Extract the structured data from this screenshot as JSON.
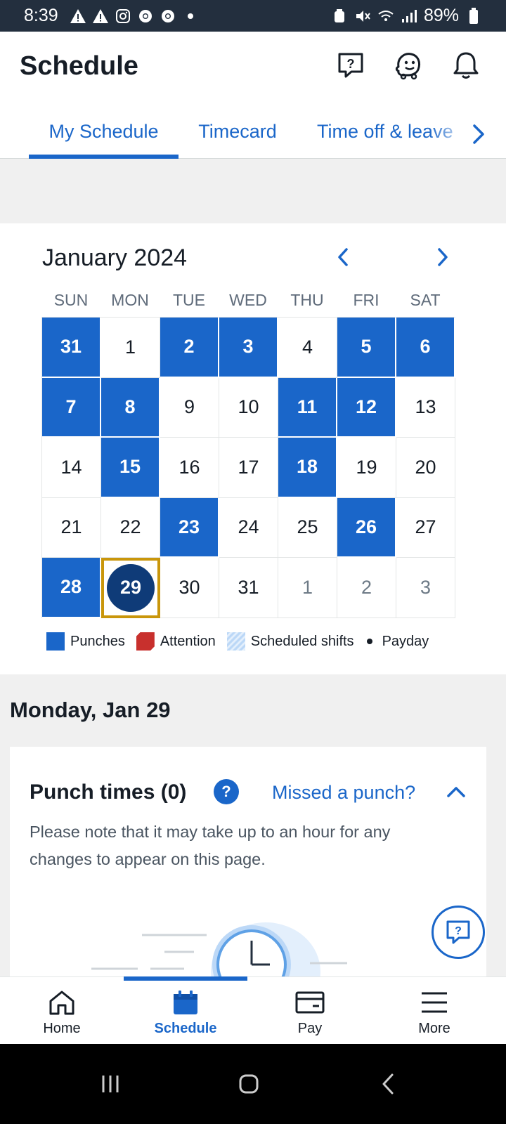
{
  "status_bar": {
    "time": "8:39",
    "battery": "89%"
  },
  "header": {
    "title": "Schedule",
    "tabs": [
      {
        "label": "My Schedule",
        "active": true
      },
      {
        "label": "Timecard",
        "active": false
      },
      {
        "label": "Time off & leave",
        "active": false
      }
    ]
  },
  "calendar": {
    "month": "January 2024",
    "weekdays": [
      "SUN",
      "MON",
      "TUE",
      "WED",
      "THU",
      "FRI",
      "SAT"
    ],
    "days": [
      {
        "label": "31",
        "state": "punch"
      },
      {
        "label": "1",
        "state": ""
      },
      {
        "label": "2",
        "state": "punch"
      },
      {
        "label": "3",
        "state": "punch"
      },
      {
        "label": "4",
        "state": ""
      },
      {
        "label": "5",
        "state": "punch"
      },
      {
        "label": "6",
        "state": "punch"
      },
      {
        "label": "7",
        "state": "punch"
      },
      {
        "label": "8",
        "state": "punch"
      },
      {
        "label": "9",
        "state": ""
      },
      {
        "label": "10",
        "state": ""
      },
      {
        "label": "11",
        "state": "punch"
      },
      {
        "label": "12",
        "state": "punch"
      },
      {
        "label": "13",
        "state": ""
      },
      {
        "label": "14",
        "state": ""
      },
      {
        "label": "15",
        "state": "punch"
      },
      {
        "label": "16",
        "state": ""
      },
      {
        "label": "17",
        "state": ""
      },
      {
        "label": "18",
        "state": "punch"
      },
      {
        "label": "19",
        "state": ""
      },
      {
        "label": "20",
        "state": ""
      },
      {
        "label": "21",
        "state": ""
      },
      {
        "label": "22",
        "state": ""
      },
      {
        "label": "23",
        "state": "punch"
      },
      {
        "label": "24",
        "state": ""
      },
      {
        "label": "25",
        "state": ""
      },
      {
        "label": "26",
        "state": "punch"
      },
      {
        "label": "27",
        "state": ""
      },
      {
        "label": "28",
        "state": "punch"
      },
      {
        "label": "29",
        "state": "today"
      },
      {
        "label": "30",
        "state": ""
      },
      {
        "label": "31",
        "state": ""
      },
      {
        "label": "1",
        "state": "muted"
      },
      {
        "label": "2",
        "state": "muted"
      },
      {
        "label": "3",
        "state": "muted"
      }
    ],
    "legend": {
      "punches": "Punches",
      "attention": "Attention",
      "scheduled": "Scheduled shifts",
      "payday": "Payday"
    }
  },
  "day_detail": {
    "heading": "Monday, Jan 29",
    "punch_title": "Punch times (0)",
    "help": "?",
    "missed_link": "Missed a punch?",
    "note": "Please note that it may take up to an hour for any changes to appear on this page."
  },
  "bottom_nav": [
    {
      "label": "Home",
      "icon": "home-icon",
      "active": false
    },
    {
      "label": "Schedule",
      "icon": "calendar-icon",
      "active": true
    },
    {
      "label": "Pay",
      "icon": "wallet-icon",
      "active": false
    },
    {
      "label": "More",
      "icon": "menu-icon",
      "active": false
    }
  ],
  "colors": {
    "accent": "#1a66c9",
    "today_fill": "#0f3b78",
    "today_outline": "#c9960b",
    "attention": "#c8302d",
    "status_bar": "#232f3e"
  }
}
